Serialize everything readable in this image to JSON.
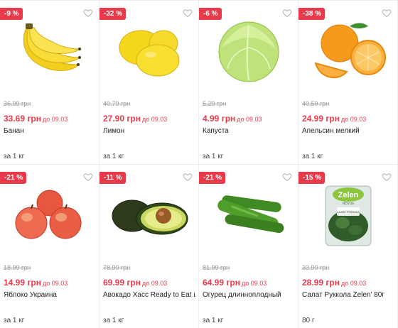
{
  "products": [
    {
      "discount": "-9 %",
      "old_price": "36.99 грн",
      "new_price": "33.69 грн",
      "until": "до 09.03",
      "name": "Банан",
      "unit": "за 1 кг",
      "image": "banana-image"
    },
    {
      "discount": "-32 %",
      "old_price": "40.79 грн",
      "new_price": "27.90 грн",
      "until": "до 09.03",
      "name": "Лимон",
      "unit": "за 1 кг",
      "image": "lemon-image"
    },
    {
      "discount": "-6 %",
      "old_price": "5.29 грн",
      "new_price": "4.99 грн",
      "until": "до 09.03",
      "name": "Капуста",
      "unit": "за 1 кг",
      "image": "cabbage-image"
    },
    {
      "discount": "-38 %",
      "old_price": "40.59 грн",
      "new_price": "24.99 грн",
      "until": "до 09.03",
      "name": "Апельсин мелкий",
      "unit": "за 1 кг",
      "image": "orange-image"
    },
    {
      "discount": "-21 %",
      "old_price": "18.99 грн",
      "new_price": "14.99 грн",
      "until": "до 09.03",
      "name": "Яблоко Украина",
      "unit": "за 1 кг",
      "image": "apple-image"
    },
    {
      "discount": "-11 %",
      "old_price": "78.99 грн",
      "new_price": "69.99 грн",
      "until": "до 09.03",
      "name": "Авокадо Хасс Ready to Eat шт",
      "unit": "за 1 кг",
      "image": "avocado-image"
    },
    {
      "discount": "-21 %",
      "old_price": "81.99 грн",
      "new_price": "64.99 грн",
      "until": "до 09.03",
      "name": "Огурец длинноплодный",
      "unit": "за 1 кг",
      "image": "cucumber-image"
    },
    {
      "discount": "-15 %",
      "old_price": "33.99 грн",
      "new_price": "28.99 грн",
      "until": "до 09.03",
      "name": "Салат Руккола Zelen' 80г",
      "unit": "80 г",
      "image": "arugula-salad-image",
      "package_brand": "Zelen",
      "package_tag": "NOVUS",
      "package_text": "САЛАТ РУККОЛА"
    }
  ],
  "colors": {
    "accent": "#e93a4b",
    "old_price": "#9a9a9a",
    "border": "#ececec"
  }
}
